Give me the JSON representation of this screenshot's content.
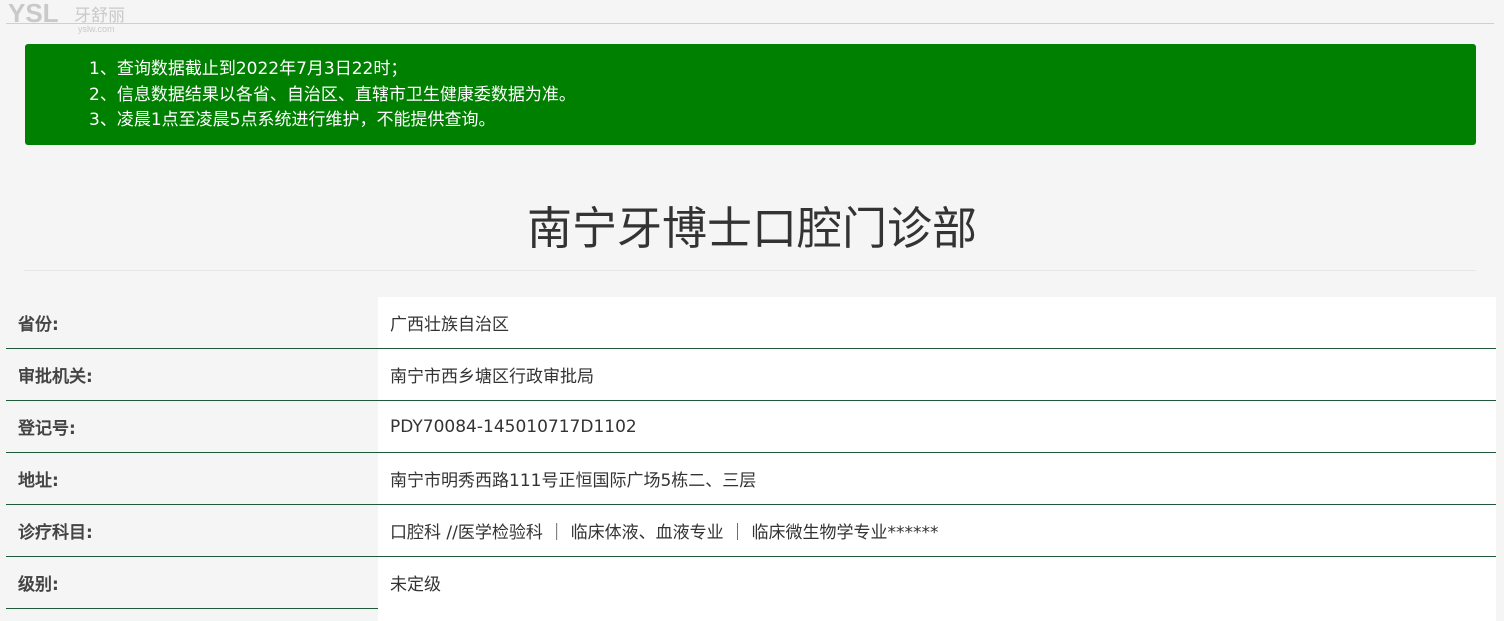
{
  "logo": {
    "brand": "YSL",
    "name_cn": "牙舒丽",
    "domain": "yslw.com"
  },
  "notice": {
    "lines": [
      "1、查询数据截止到2022年7月3日22时；",
      "2、信息数据结果以各省、自治区、直辖市卫生健康委数据为准。",
      "3、凌晨1点至凌晨5点系统进行维护，不能提供查询。"
    ]
  },
  "title": "南宁牙博士口腔门诊部",
  "details": [
    {
      "label": "省份:",
      "value": "广西壮族自治区"
    },
    {
      "label": "审批机关:",
      "value": "南宁市西乡塘区行政审批局"
    },
    {
      "label": "登记号:",
      "value": "PDY70084-145010717D1102"
    },
    {
      "label": "地址:",
      "value": "南宁市明秀西路111号正恒国际广场5栋二、三层"
    },
    {
      "label": "诊疗科目:",
      "value": "口腔科 //医学检验科 ｜ 临床体液、血液专业 ｜ 临床微生物学专业******"
    },
    {
      "label": "级别:",
      "value": "未定级"
    }
  ],
  "colors": {
    "notice_bg": "#008000",
    "row_divider": "#1f5a3a",
    "page_bg": "#f5f5f5"
  }
}
